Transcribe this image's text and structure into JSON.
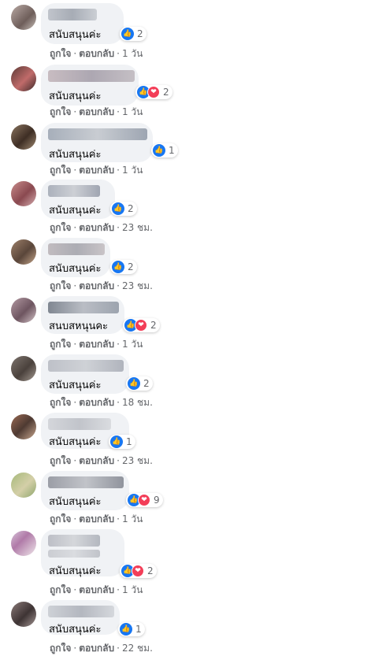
{
  "ui": {
    "like_label": "ถูกใจ",
    "reply_label": "ตอบกลับ",
    "dot": "·"
  },
  "comments": [
    {
      "text": "สนับสนุนค่ะ",
      "reactions": 2,
      "has_love": false,
      "time": "1 วัน"
    },
    {
      "text": "สนับสนุนค่ะ",
      "reactions": 2,
      "has_love": true,
      "time": "1 วัน"
    },
    {
      "text": "สนับสนุนค่ะ",
      "reactions": 1,
      "has_love": false,
      "time": "1 วัน"
    },
    {
      "text": "สนับสนุนค่ะ",
      "reactions": 2,
      "has_love": false,
      "time": "23 ชม."
    },
    {
      "text": "สนับสนุนค่ะ",
      "reactions": 2,
      "has_love": false,
      "time": "23 ชม."
    },
    {
      "text": "สนบสหนุนคะ",
      "reactions": 2,
      "has_love": true,
      "time": "1 วัน"
    },
    {
      "text": "สนับสนุนค่ะ",
      "reactions": 2,
      "has_love": false,
      "time": "18 ชม."
    },
    {
      "text": "สนับสนุนค่ะ",
      "reactions": 1,
      "has_love": false,
      "time": "23 ชม."
    },
    {
      "text": "สนับสนุนค่ะ",
      "reactions": 9,
      "has_love": true,
      "time": "1 วัน"
    },
    {
      "text": "สนับสนุนค่ะ",
      "reactions": 2,
      "has_love": true,
      "time": "1 วัน"
    },
    {
      "text": "สนับสนุนค่ะ",
      "reactions": 1,
      "has_love": false,
      "time": "22 ชม."
    }
  ]
}
